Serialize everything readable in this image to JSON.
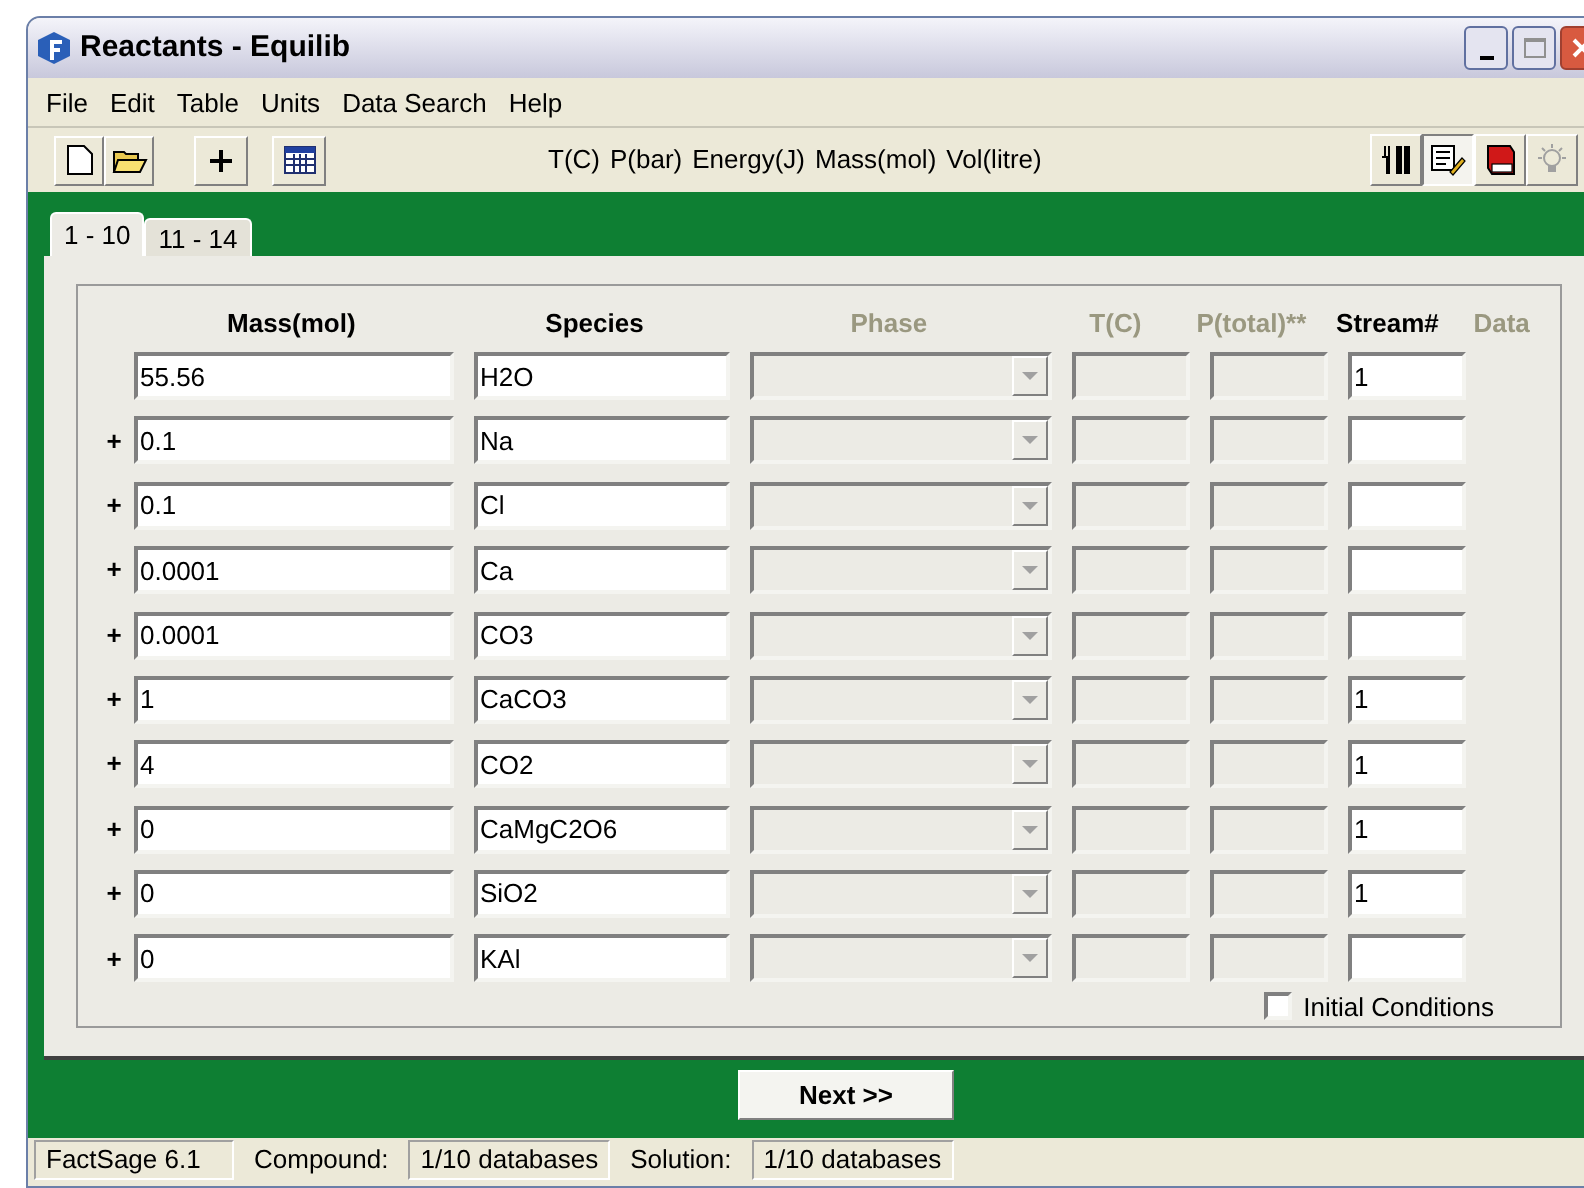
{
  "window": {
    "title": "Reactants - Equilib"
  },
  "menu": [
    "File",
    "Edit",
    "Table",
    "Units",
    "Data Search",
    "Help"
  ],
  "units": [
    "T(C)",
    "P(bar)",
    "Energy(J)",
    "Mass(mol)",
    "Vol(litre)"
  ],
  "right_tools": [
    {
      "kind": "utensils",
      "disabled": false,
      "selected": false
    },
    {
      "kind": "edit-list",
      "disabled": false,
      "selected": true
    },
    {
      "kind": "book",
      "disabled": false,
      "selected": false
    },
    {
      "kind": "bulb",
      "disabled": true,
      "selected": false
    }
  ],
  "tabs": [
    {
      "label": "1 - 10",
      "selected": true
    },
    {
      "label": "11 - 14",
      "selected": false
    }
  ],
  "columns": [
    {
      "label": "Mass(mol)",
      "disabled": false
    },
    {
      "label": "Species",
      "disabled": false
    },
    {
      "label": "Phase",
      "disabled": true
    },
    {
      "label": "T(C)",
      "disabled": true
    },
    {
      "label": "P(total)**",
      "disabled": true
    },
    {
      "label": "Stream#",
      "disabled": false
    },
    {
      "label": "Data",
      "disabled": true
    }
  ],
  "rows": [
    {
      "mass": "55.56",
      "species": "H2O",
      "stream": "1"
    },
    {
      "operator": "+",
      "mass": "0.1",
      "species": "Na"
    },
    {
      "operator": "+",
      "mass": "0.1",
      "species": "Cl"
    },
    {
      "operator": "+",
      "mass": "0.0001",
      "species": "Ca"
    },
    {
      "operator": "+",
      "mass": "0.0001",
      "species": "CO3"
    },
    {
      "operator": "+",
      "mass": "1",
      "species": "CaCO3",
      "stream": "1"
    },
    {
      "operator": "+",
      "mass": "4",
      "species": "CO2",
      "stream": "1"
    },
    {
      "operator": "+",
      "mass": "0",
      "species": "CaMgC2O6",
      "stream": "1"
    },
    {
      "operator": "+",
      "mass": "0",
      "species": "SiO2",
      "stream": "1"
    },
    {
      "operator": "+",
      "mass": "0",
      "species": "KAl"
    }
  ],
  "initial_conditions": {
    "label": "Initial Conditions",
    "checked": false
  },
  "next_button": "Next >>",
  "status_bar": [
    {
      "kind": "text",
      "text": "FactSage 6.1",
      "boxed": true
    },
    {
      "kind": "text",
      "text": "Compound:",
      "boxed": false
    },
    {
      "kind": "text",
      "text": "1/10 databases",
      "boxed": true
    },
    {
      "kind": "text",
      "text": "Solution:",
      "boxed": false
    },
    {
      "kind": "text",
      "text": "1/10 databases",
      "boxed": true
    }
  ]
}
